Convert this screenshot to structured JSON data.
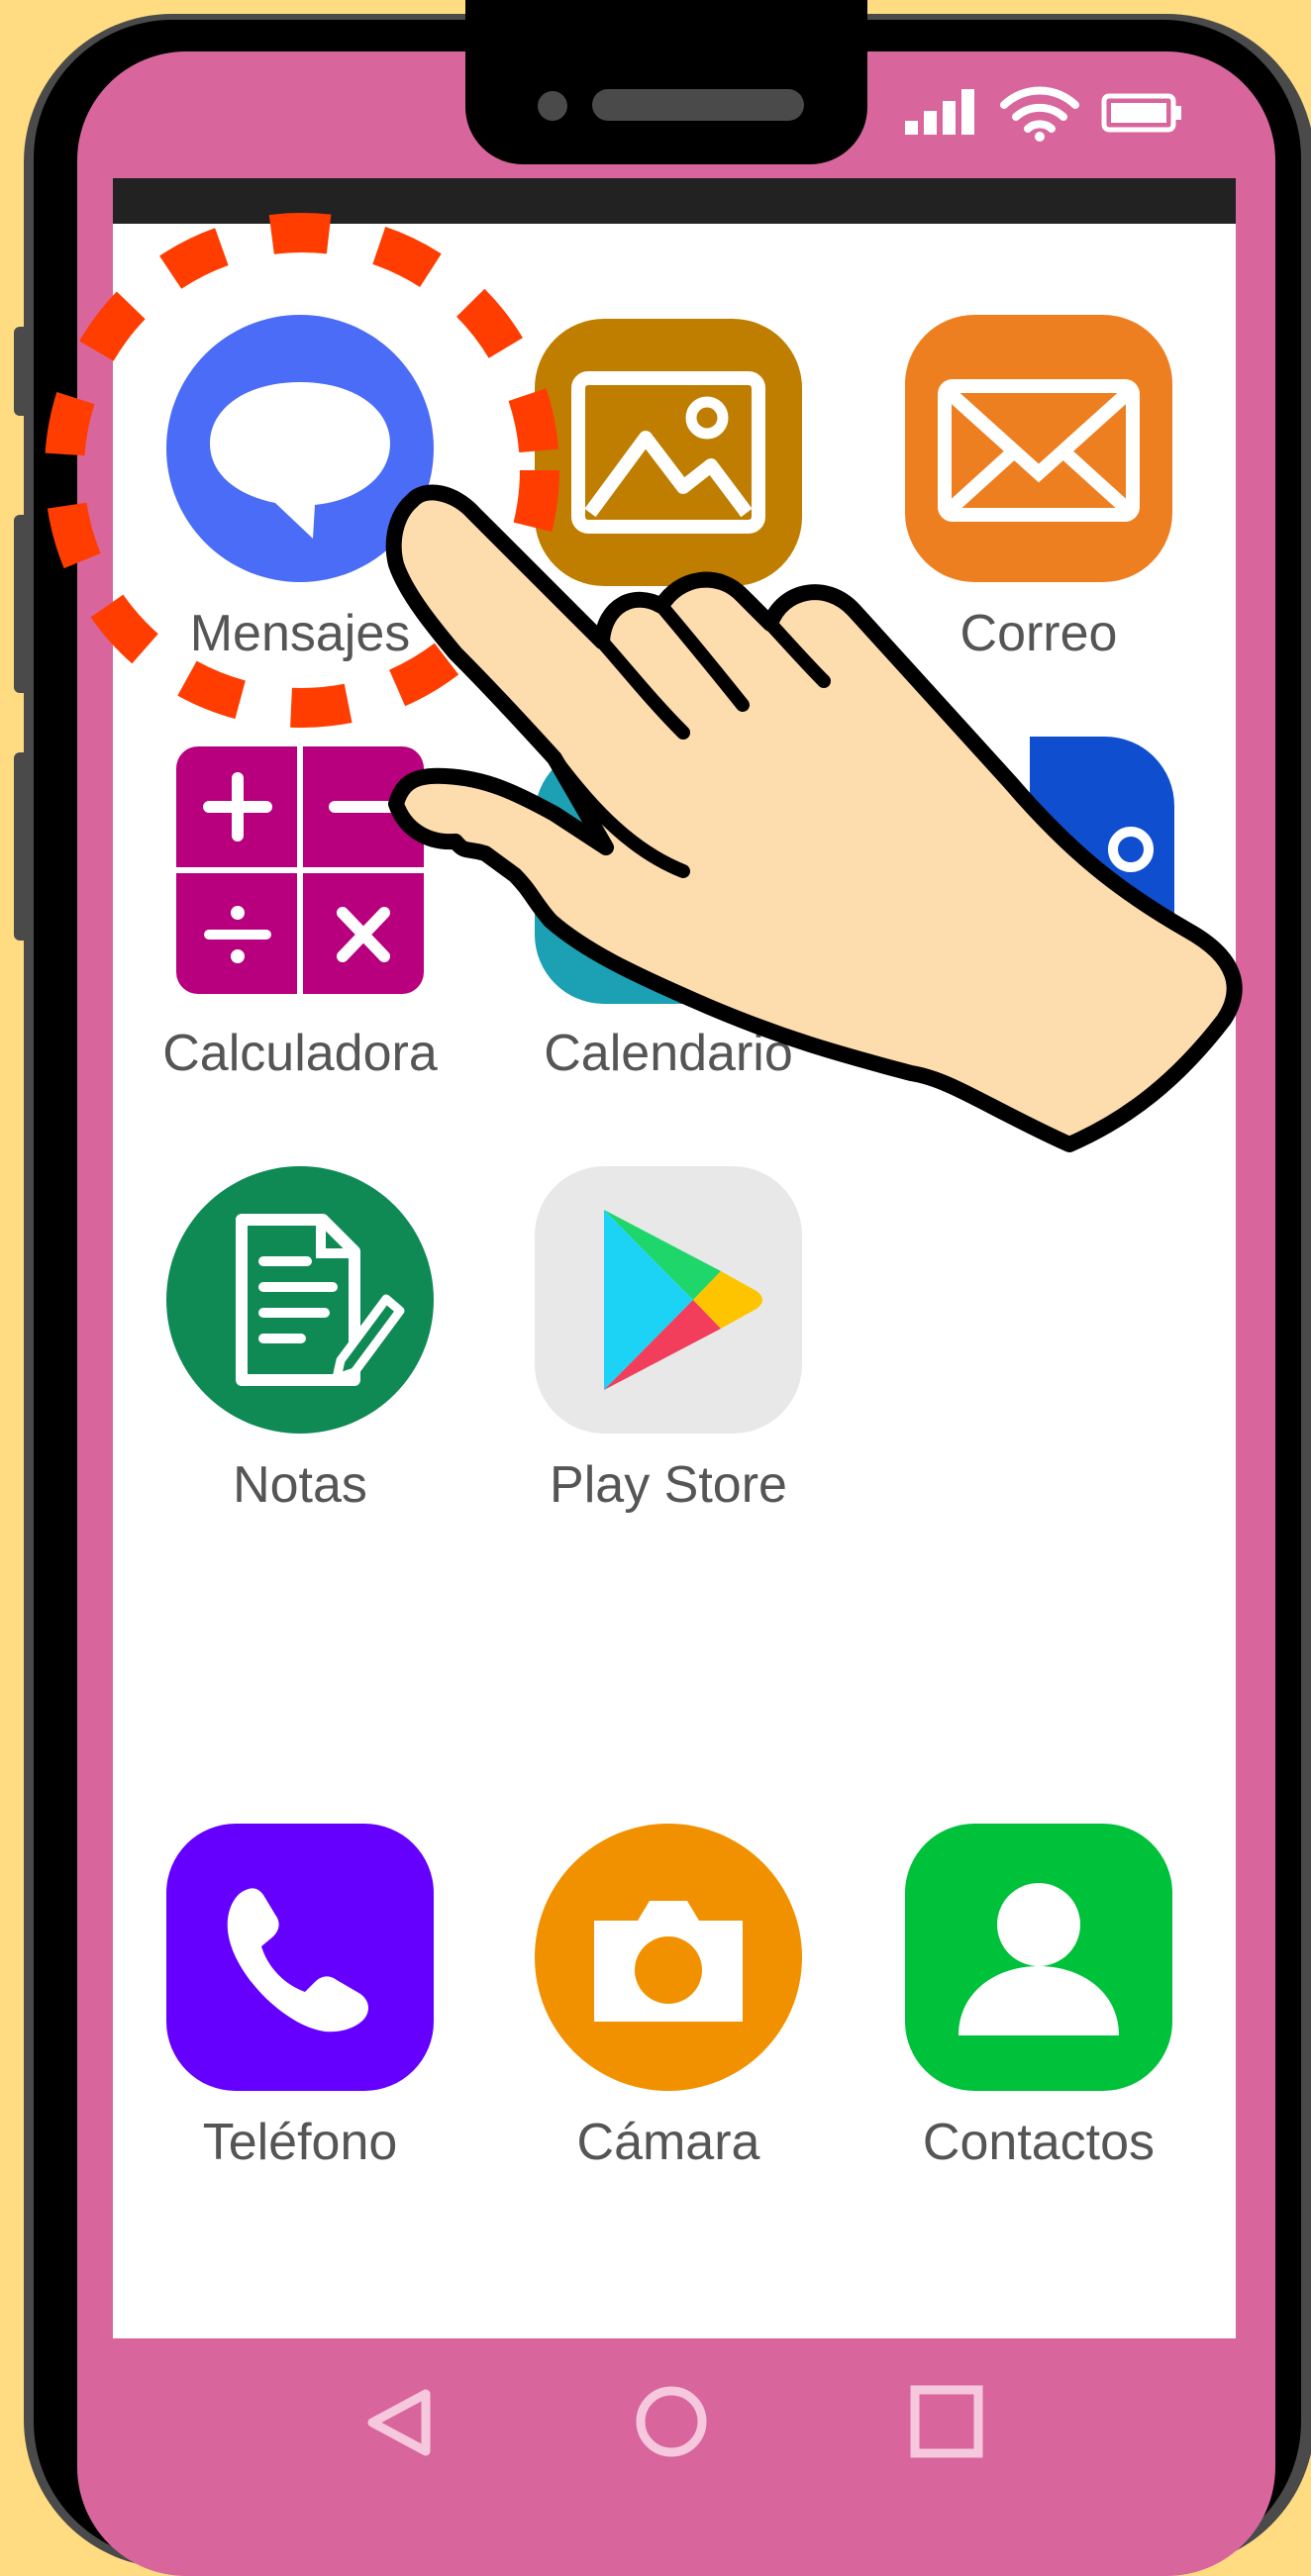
{
  "apps": {
    "mensajes": {
      "label": "Mensajes",
      "color": "#4A6CF7",
      "icon": "chat-bubble-icon"
    },
    "galeria": {
      "label": "",
      "color": "#BF7E00",
      "icon": "image-icon"
    },
    "correo": {
      "label": "Correo",
      "color": "#EE7F20",
      "icon": "envelope-icon"
    },
    "calculadora": {
      "label": "Calculadora",
      "color": "#B8007E",
      "icon": "calculator-icon"
    },
    "calendario": {
      "label": "Calendario",
      "color": "#1BA0B4",
      "icon": "calendar-icon"
    },
    "partial_blue": {
      "color": "#0F4FCF"
    },
    "notas": {
      "label": "Notas",
      "color": "#0F8A55",
      "icon": "notes-icon"
    },
    "play_store": {
      "label": "Play Store",
      "color": "#E8E8E8",
      "icon": "play-store-icon"
    }
  },
  "dock": {
    "telefono": {
      "label": "Teléfono",
      "color": "#6500FF",
      "icon": "phone-icon"
    },
    "camara": {
      "label": "Cámara",
      "color": "#F29100",
      "icon": "camera-icon"
    },
    "contactos": {
      "label": "Contactos",
      "color": "#00C13A",
      "icon": "person-icon"
    }
  },
  "nav": {
    "back": "back-triangle-icon",
    "home": "home-circle-icon",
    "recents": "recents-square-icon"
  },
  "status_bar": {
    "signal": "signal-icon",
    "wifi": "wifi-icon",
    "battery": "battery-icon"
  },
  "highlight": {
    "color": "#FF3D00",
    "target": "Mensajes"
  },
  "hand": {
    "skin": "#FDDCAE",
    "outline": "#000000"
  }
}
